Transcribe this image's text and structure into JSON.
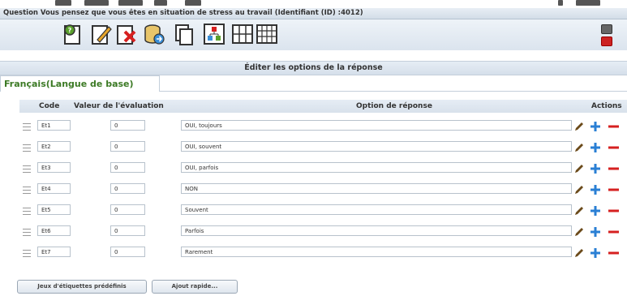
{
  "question_bar": {
    "text": "Question Vous pensez que vous êtes en situation de stress au travail (Identifiant (ID) :4012)"
  },
  "toolbar": {
    "icons": [
      "help-icon",
      "edit-icon",
      "delete-icon",
      "export-icon",
      "copy-icon",
      "hierarchy-icon",
      "grid-icon",
      "table-icon"
    ]
  },
  "section": {
    "title": "Éditer les options de la réponse"
  },
  "language_tab": {
    "label": "Français(Langue de base)"
  },
  "table": {
    "headers": {
      "code": "Code",
      "assessment": "Valeur de l'évaluation",
      "option": "Option de réponse",
      "actions": "Actions"
    },
    "rows": [
      {
        "code": "Et1",
        "value": "0",
        "option": "OUI, toujours"
      },
      {
        "code": "Et2",
        "value": "0",
        "option": "OUI, souvent"
      },
      {
        "code": "Et3",
        "value": "0",
        "option": "OUI, parfois"
      },
      {
        "code": "Et4",
        "value": "0",
        "option": "NON"
      },
      {
        "code": "Et5",
        "value": "0",
        "option": "Souvent"
      },
      {
        "code": "Et6",
        "value": "0",
        "option": "Parfois"
      },
      {
        "code": "Et7",
        "value": "0",
        "option": "Rarement"
      }
    ]
  },
  "buttons": {
    "predefined_labels": "Jeux d'étiquettes prédéfinis",
    "quick_add": "Ajout rapide..."
  },
  "colors": {
    "tab_text": "#3c7a25",
    "add_icon": "#2a7fd4",
    "remove_icon": "#d62020",
    "pencil_icon": "#6b4a1a"
  }
}
